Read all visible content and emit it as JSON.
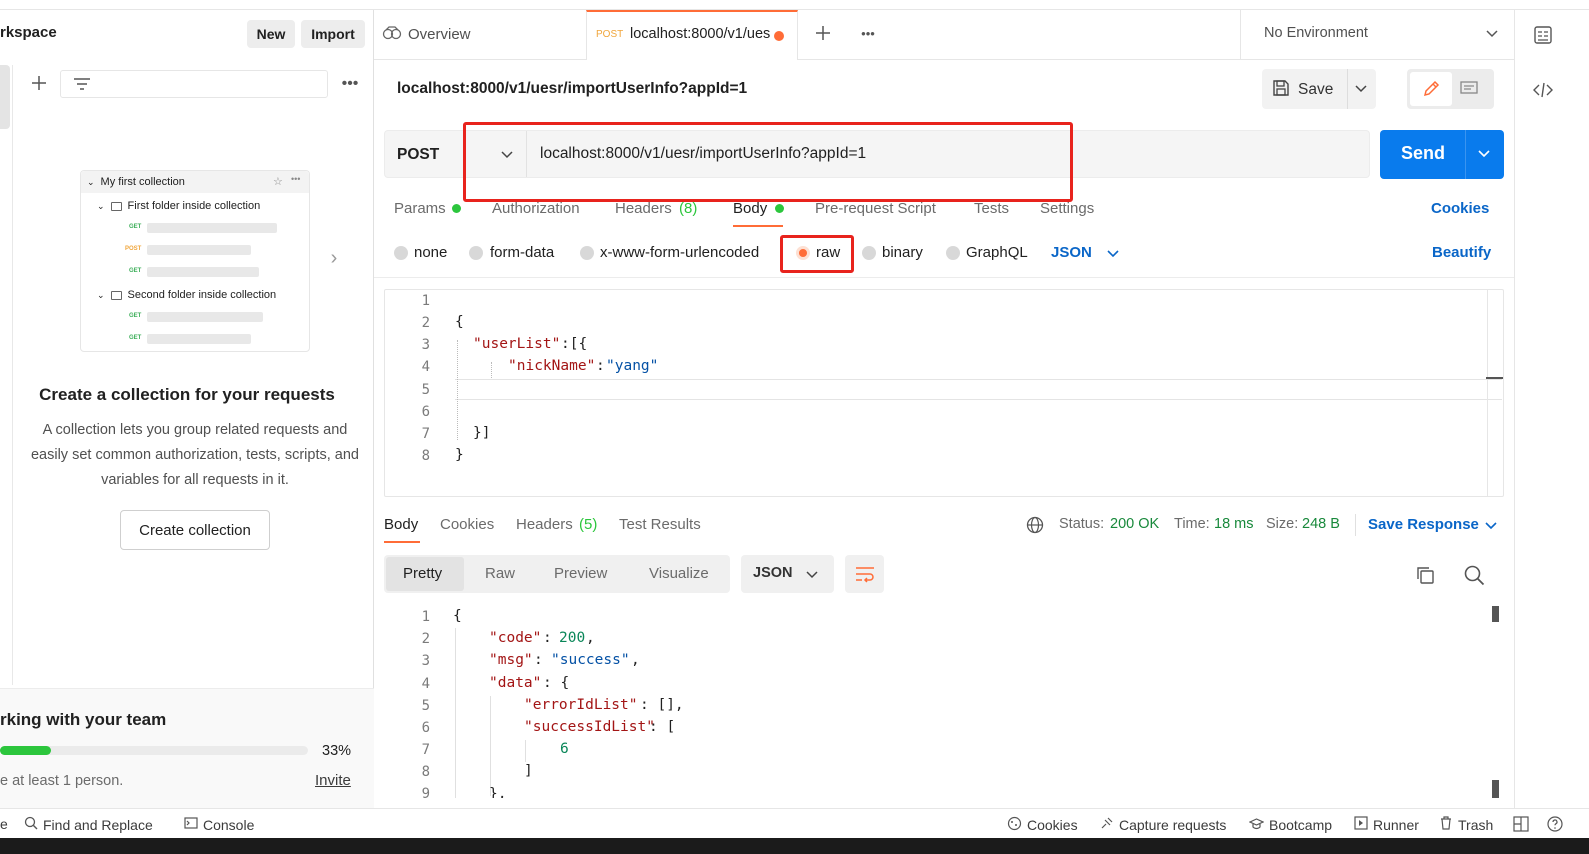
{
  "sidebar": {
    "workspace_title": "rkspace",
    "new_label": "New",
    "import_label": "Import",
    "illustration": {
      "collection": "My first collection",
      "folder1": "First folder inside collection",
      "folder2": "Second folder inside collection",
      "get": "GET",
      "post": "POST"
    },
    "collection_title": "Create a collection for your requests",
    "collection_desc": "A collection lets you group related requests and easily set common authorization, tests, scripts, and variables for all requests in it.",
    "create_collection_label": "Create collection",
    "team_title": "rking with your team",
    "team_progress_label": "33%",
    "team_progress": 0.33,
    "team_desc": "e at least 1 person.",
    "invite_label": "Invite"
  },
  "tabs": {
    "overview_label": "Overview",
    "active_method": "POST",
    "active_url": "localhost:8000/v1/ues",
    "environment": "No Environment"
  },
  "request": {
    "title": "localhost:8000/v1/uesr/importUserInfo?appId=1",
    "save_label": "Save",
    "method": "POST",
    "url": "localhost:8000/v1/uesr/importUserInfo?appId=1",
    "send_label": "Send",
    "tabs": [
      "Params",
      "Authorization",
      "Headers",
      "(8)",
      "Body",
      "Pre-request Script",
      "Tests",
      "Settings"
    ],
    "cookies_label": "Cookies",
    "body_types": [
      "none",
      "form-data",
      "x-www-form-urlencoded",
      "raw",
      "binary",
      "GraphQL"
    ],
    "body_format": "JSON",
    "beautify_label": "Beautify",
    "body_lines": [
      "1",
      "2",
      "3",
      "4",
      "5",
      "6",
      "7",
      "8"
    ],
    "code": {
      "l2": "{",
      "l3_key": "\"userList\"",
      "l3_rest": ":[{",
      "l4_key": "\"nickName\"",
      "l4_colon": ":",
      "l4_val": "\"yang\"",
      "l7": "}]",
      "l8": "}"
    }
  },
  "response": {
    "tabs": [
      "Body",
      "Cookies",
      "Headers",
      "(5)",
      "Test Results"
    ],
    "status_label": "Status:",
    "status_value": "200 OK",
    "time_label": "Time:",
    "time_value": "18 ms",
    "size_label": "Size:",
    "size_value": "248 B",
    "save_response_label": "Save Response",
    "views": [
      "Pretty",
      "Raw",
      "Preview",
      "Visualize"
    ],
    "format": "JSON",
    "lines": [
      "1",
      "2",
      "3",
      "4",
      "5",
      "6",
      "7",
      "8",
      "9"
    ],
    "code": {
      "l1": "{",
      "code_key": "\"code\"",
      "code_val": "200",
      "msg_key": "\"msg\"",
      "msg_val": "\"success\"",
      "data_key": "\"data\"",
      "data_open": ": {",
      "err_key": "\"errorIdList\"",
      "err_val": ": [],",
      "succ_key": "\"successIdList\"",
      "succ_open": ": [",
      "item": "6",
      "close_arr": "]",
      "close_obj": "},"
    }
  },
  "statusbar": {
    "left_cut": "e",
    "find_replace": "Find and Replace",
    "console": "Console",
    "cookies": "Cookies",
    "capture": "Capture requests",
    "bootcamp": "Bootcamp",
    "runner": "Runner",
    "trash": "Trash"
  },
  "colors": {
    "accent": "#ff6c37",
    "send": "#097bed",
    "success": "#2cc63d",
    "annotation": "#e8231d"
  }
}
